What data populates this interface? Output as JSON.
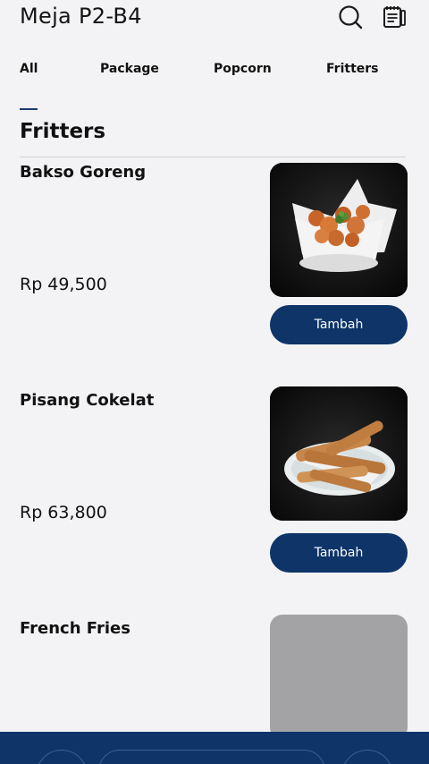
{
  "header": {
    "title": "Meja P2-B4",
    "search_icon": "search-icon",
    "orders_icon": "receipt-icon"
  },
  "tabs": [
    {
      "label": "All"
    },
    {
      "label": "Package"
    },
    {
      "label": "Popcorn"
    },
    {
      "label": "Fritters"
    }
  ],
  "section": {
    "title": "Fritters"
  },
  "items": [
    {
      "name": "Bakso Goreng",
      "price": "Rp 49,500",
      "button_label": "Tambah",
      "image": "fried-meatballs-in-bowl"
    },
    {
      "name": "Pisang Cokelat",
      "price": "Rp 63,800",
      "button_label": "Tambah",
      "image": "chocolate-banana-rolls-on-plate"
    },
    {
      "name": "French Fries",
      "image": "image-placeholder"
    }
  ],
  "colors": {
    "accent": "#0e3468",
    "background": "#f3f3f5",
    "placeholder": "#a3a3a6"
  }
}
